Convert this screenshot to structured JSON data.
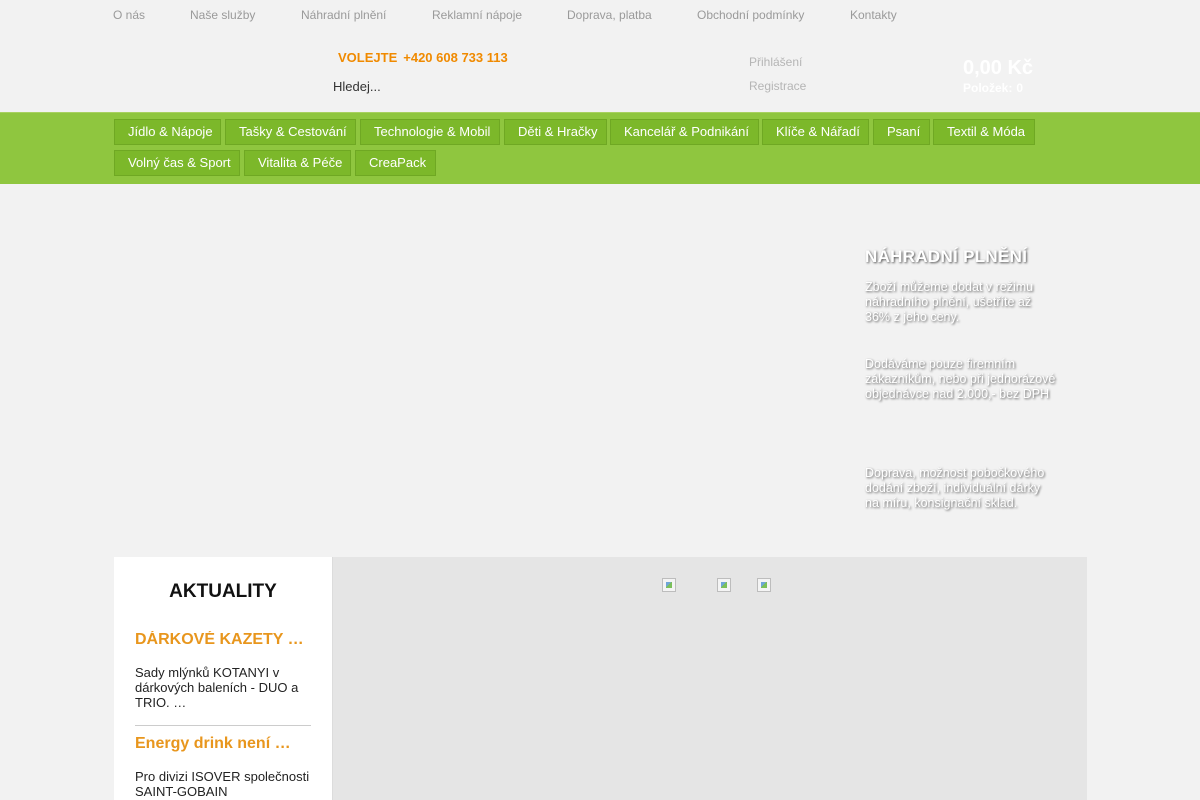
{
  "top_nav": [
    "O nás",
    "Naše služby",
    "Náhradní plnění",
    "Reklamní nápoje",
    "Doprava, platba",
    "Obchodní podmínky",
    "Kontakty"
  ],
  "header": {
    "call_label": "VOLEJTE",
    "phone": "+420 608 733 113",
    "search_placeholder": "Hledej...",
    "login_link": "Přihlášení",
    "register_link": "Registrace",
    "cart_total": "0,00 Kč",
    "cart_items_label": "Položek:",
    "cart_items_count": "0"
  },
  "categories": [
    "Jídlo & Nápoje",
    "Tašky & Cestování",
    "Technologie & Mobil",
    "Děti & Hračky",
    "Kancelář & Podnikání",
    "Klíče & Nářadí",
    "Psaní",
    "Textil & Móda",
    "Volný čas & Sport",
    "Vitalita & Péče",
    "CreaPack"
  ],
  "promo": {
    "title": "NÁHRADNÍ PLNĚNÍ",
    "p1": "Zboží můžeme dodat v režimu náhradního plnění, ušetříte až 36% z jeho ceny.",
    "p2": "Dodáváme pouze firemním zákazníkům, nebo při jednorázové objednávce nad 2.000,- bez DPH",
    "p3": "Doprava, možnost pobočkového dodání zboží, individuální dárky na míru, konsignační sklad."
  },
  "news": {
    "heading": "AKTUALITY",
    "items": [
      {
        "title": "DÁRKOVÉ KAZETY …",
        "text": "Sady mlýnků KOTANYI v dárkových baleních - DUO a TRIO. …"
      },
      {
        "title": "Energy drink není …",
        "text": "Pro divizi ISOVER společnosti SAINT-GOBAIN"
      }
    ]
  },
  "icons": {
    "broken_image": "broken-image-icon"
  }
}
